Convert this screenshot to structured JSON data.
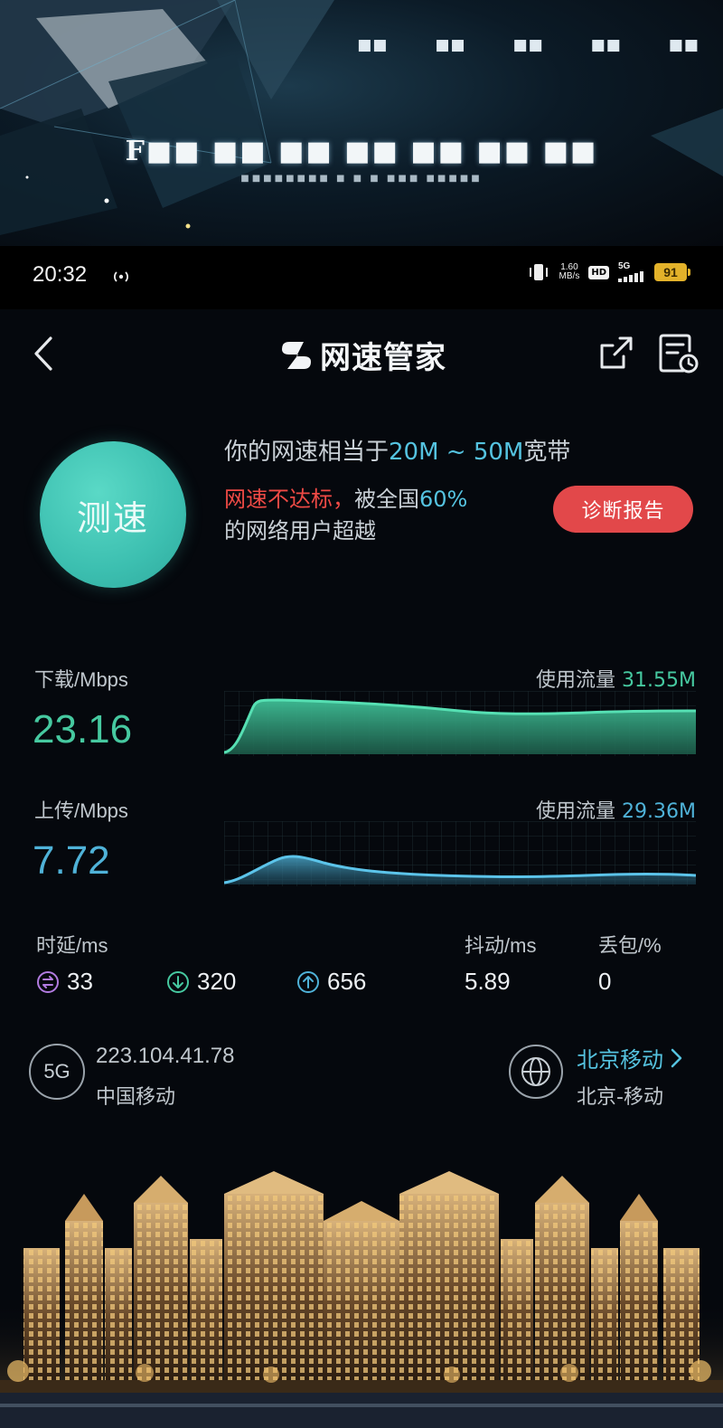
{
  "banner": {
    "menu": [
      "■■",
      "■■",
      "■■",
      "■■",
      "■■"
    ],
    "title": "F■■ ■■ ■■ ■■ ■■ ■■ ■■",
    "subtitle": "■■■■■■■■ ■ ■ ■ ■■■ ■■■■■"
  },
  "status_bar": {
    "time": "20:32",
    "net_rate_value": "1.60",
    "net_rate_unit": "MB/s",
    "hd": "HD",
    "network": "5G",
    "battery": "91",
    "colors": {
      "battery": "#e3b22a"
    }
  },
  "navbar": {
    "title": "网速管家",
    "icons": [
      "chevron-left-icon",
      "app-logo-icon",
      "share-icon",
      "history-icon"
    ]
  },
  "speed_test": {
    "button_label": "测速",
    "line1_prefix": "你的网速相当于",
    "line1_highlight": "20M ~ 50M",
    "line1_suffix": "宽带",
    "warning": "网速不达标，",
    "line2_mid": "被全国",
    "line2_percent": "60%",
    "line3": "的网络用户超越",
    "diagnose_label": "诊断报告"
  },
  "download": {
    "label": "下载/Mbps",
    "value": "23.16",
    "usage_prefix": "使用流量",
    "usage_value": "31.55M",
    "color": "#46c9a0"
  },
  "upload": {
    "label": "上传/Mbps",
    "value": "7.72",
    "usage_prefix": "使用流量",
    "usage_value": "29.36M",
    "color": "#4fb2d8"
  },
  "stats": {
    "latency_title": "时延/ms",
    "idle": "33",
    "down_latency": "320",
    "up_latency": "656",
    "jitter_title": "抖动/ms",
    "jitter": "5.89",
    "loss_title": "丢包/%",
    "loss": "0"
  },
  "network_info": {
    "badge": "5G",
    "ip": "223.104.41.78",
    "isp": "中国移动",
    "server": "北京移动",
    "server_location": "北京-移动"
  }
}
